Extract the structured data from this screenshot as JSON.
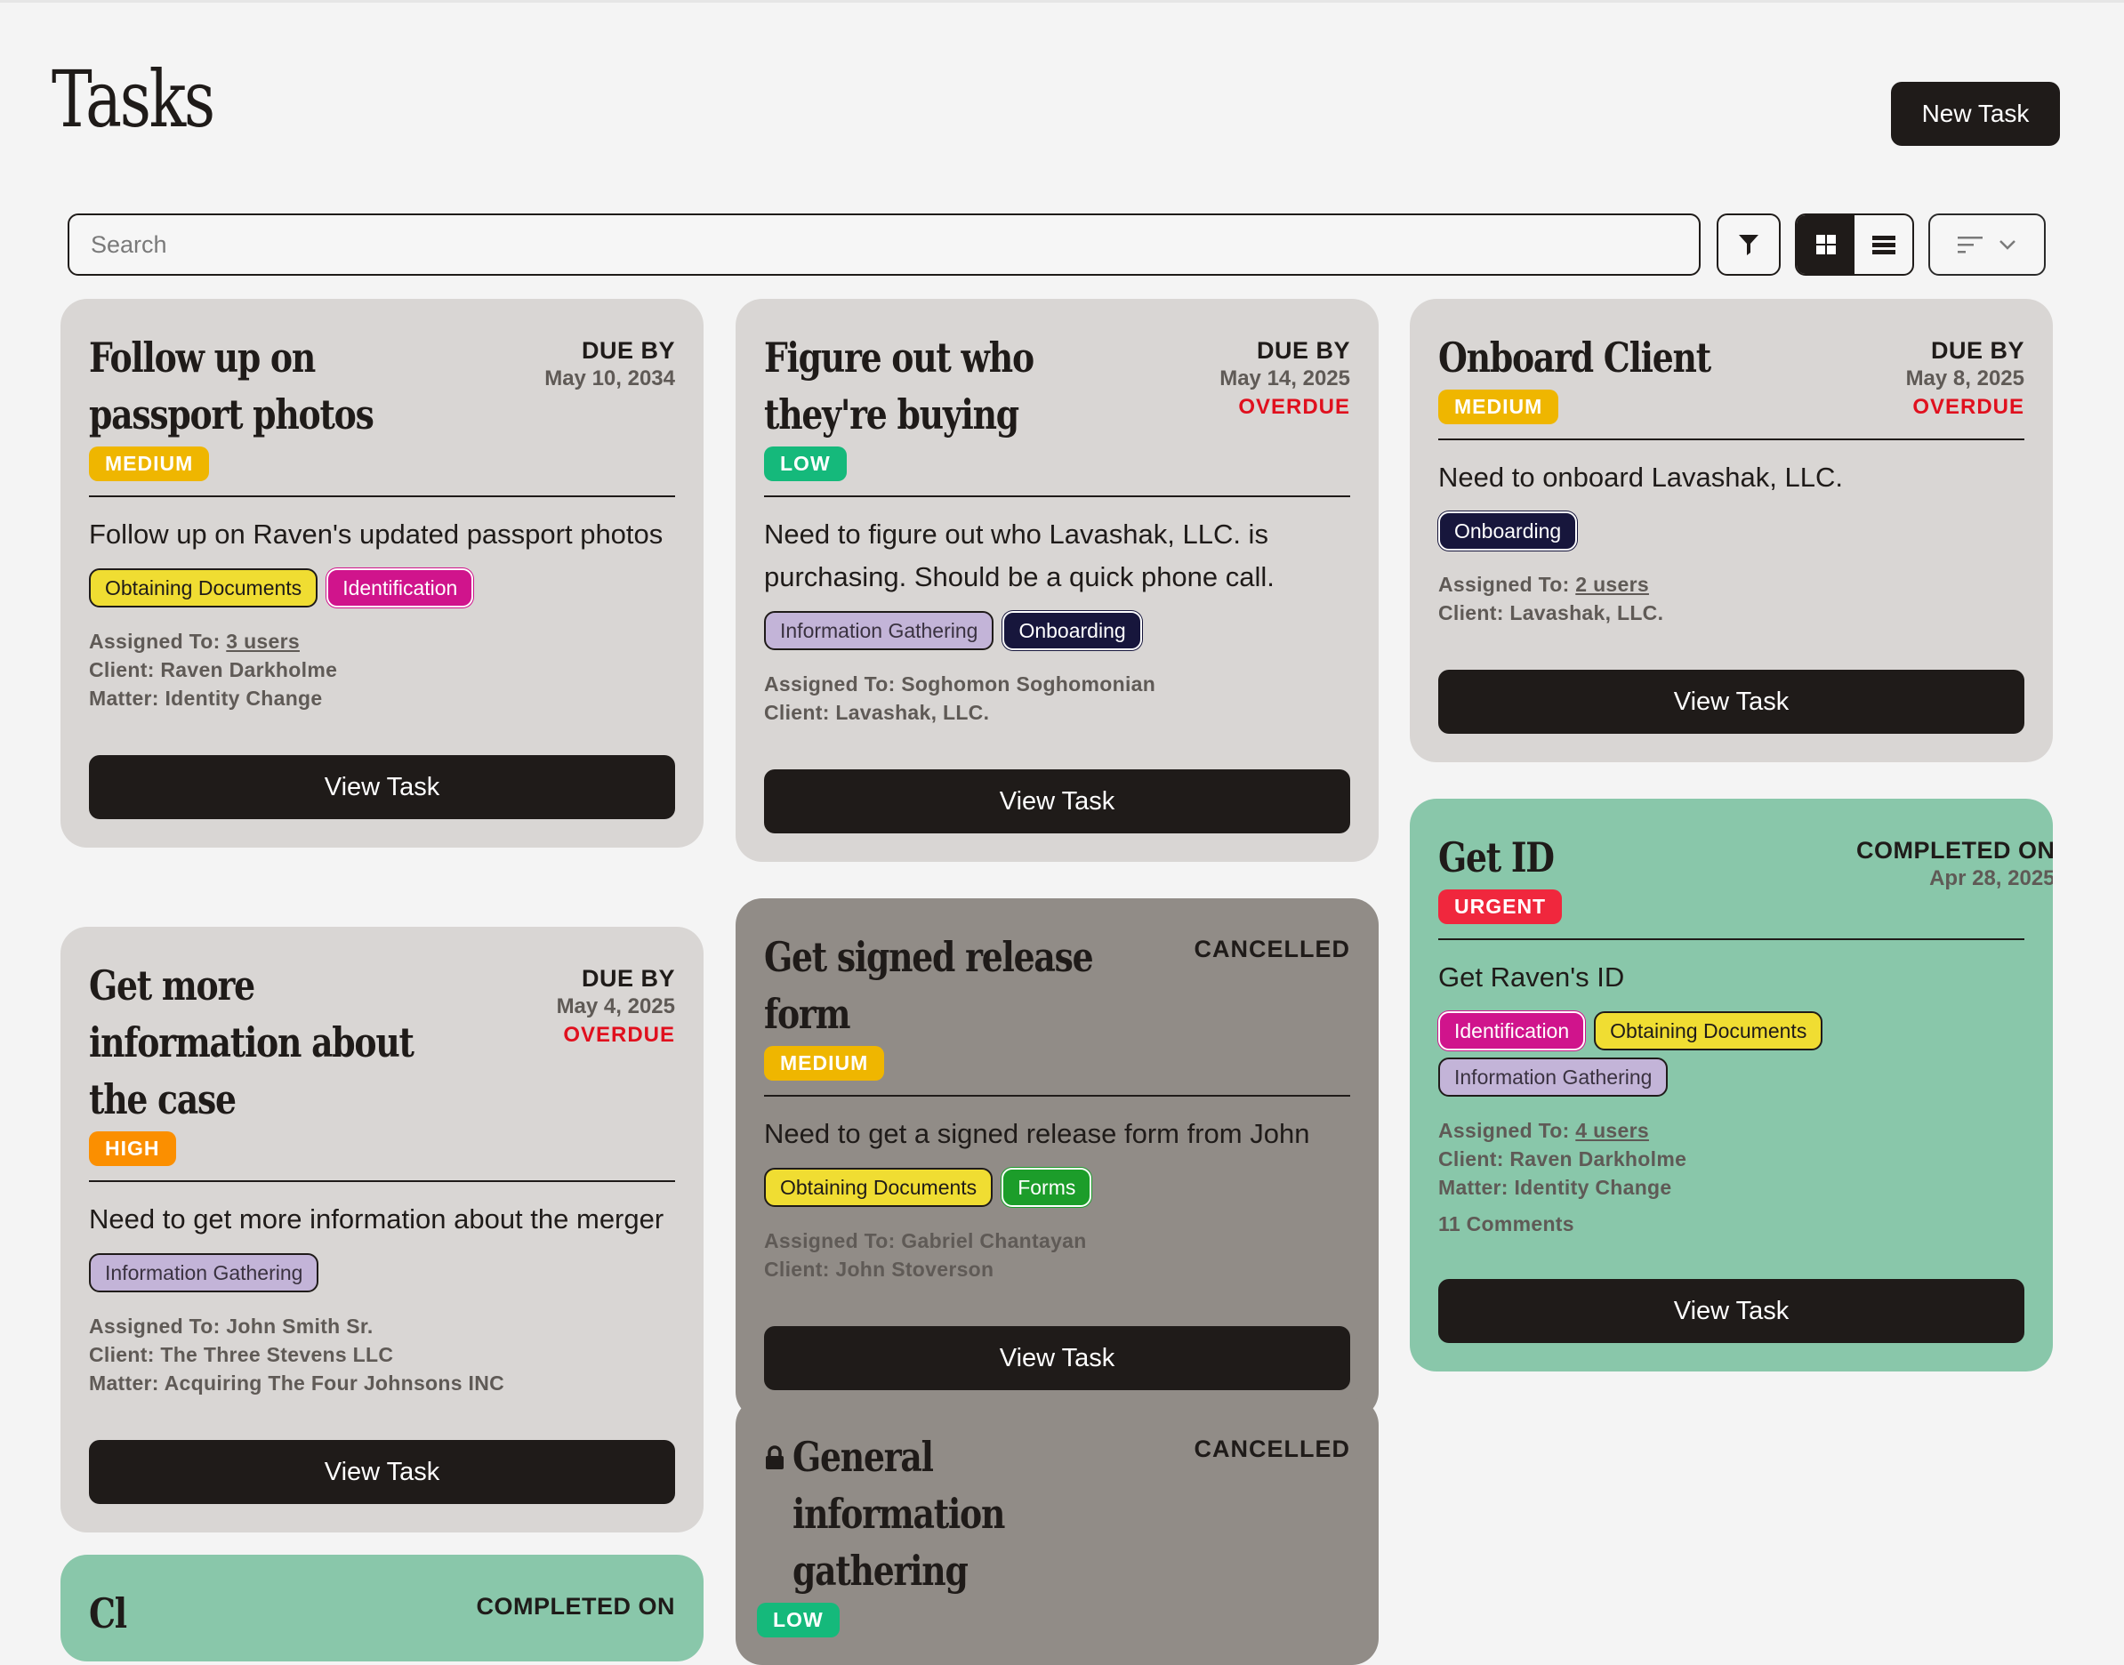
{
  "header": {
    "title": "Tasks",
    "new_task_label": "New Task"
  },
  "toolbar": {
    "search_placeholder": "Search",
    "filter_icon": "filter-icon",
    "view_mode": "grid",
    "sort_icon": "sort-icon"
  },
  "labels": {
    "due_by": "DUE BY",
    "overdue": "OVERDUE",
    "completed_on": "COMPLETED ON",
    "cancelled": "CANCELLED",
    "view_task": "View Task",
    "assigned_to": "Assigned To:",
    "client": "Client:",
    "matter": "Matter:"
  },
  "colors": {
    "card_default": "#d9d6d4",
    "card_cancelled": "#918c87",
    "card_completed": "#89c7aa",
    "priority_medium": "#efb600",
    "priority_low": "#15b97b",
    "priority_high": "#fb8f00",
    "priority_urgent": "#f0273d",
    "overdue": "#e0101e"
  },
  "tasks": [
    {
      "title": "Follow up on passport photos",
      "status": "due",
      "date": "May 10, 2034",
      "overdue": false,
      "priority": "MEDIUM",
      "description": "Follow up on Raven's updated passport photos",
      "tags": [
        "Obtaining Documents",
        "Identification"
      ],
      "assigned": "3 users",
      "client": "Raven Darkholme",
      "matter": "Identity Change"
    },
    {
      "title": "Figure out who they're buying",
      "status": "due",
      "date": "May 14, 2025",
      "overdue": true,
      "priority": "LOW",
      "description": "Need to figure out who Lavashak, LLC. is purchasing. Should be a quick phone call.",
      "tags": [
        "Information Gathering",
        "Onboarding"
      ],
      "assigned": "Soghomon Soghomonian",
      "client": "Lavashak, LLC."
    },
    {
      "title": "Onboard Client",
      "status": "due",
      "date": "May 8, 2025",
      "overdue": true,
      "priority": "MEDIUM",
      "description": "Need to onboard Lavashak, LLC.",
      "tags": [
        "Onboarding"
      ],
      "assigned": "2 users",
      "client": "Lavashak, LLC."
    },
    {
      "title": "Get more information about the case",
      "status": "due",
      "date": "May 4, 2025",
      "overdue": true,
      "priority": "HIGH",
      "description": "Need to get more information about the merger",
      "tags": [
        "Information Gathering"
      ],
      "assigned": "John Smith Sr.",
      "client": "The Three Stevens LLC",
      "matter": "Acquiring The Four Johnsons INC"
    },
    {
      "title": "Get signed release form",
      "status": "cancelled",
      "priority": "MEDIUM",
      "description": "Need to get a signed release form from John",
      "tags": [
        "Obtaining Documents",
        "Forms"
      ],
      "assigned": "Gabriel Chantayan",
      "client": "John Stoverson"
    },
    {
      "title": "Get ID",
      "status": "completed",
      "date": "Apr 28, 2025",
      "priority": "URGENT",
      "description": "Get Raven's ID",
      "tags": [
        "Identification",
        "Obtaining Documents",
        "Information Gathering"
      ],
      "assigned": "4 users",
      "client": "Raven Darkholme",
      "matter": "Identity Change",
      "comments": "11 Comments"
    },
    {
      "title": "General information gathering",
      "status": "cancelled",
      "locked": true,
      "priority": "LOW"
    },
    {
      "title": "Cl",
      "status": "completed"
    }
  ]
}
